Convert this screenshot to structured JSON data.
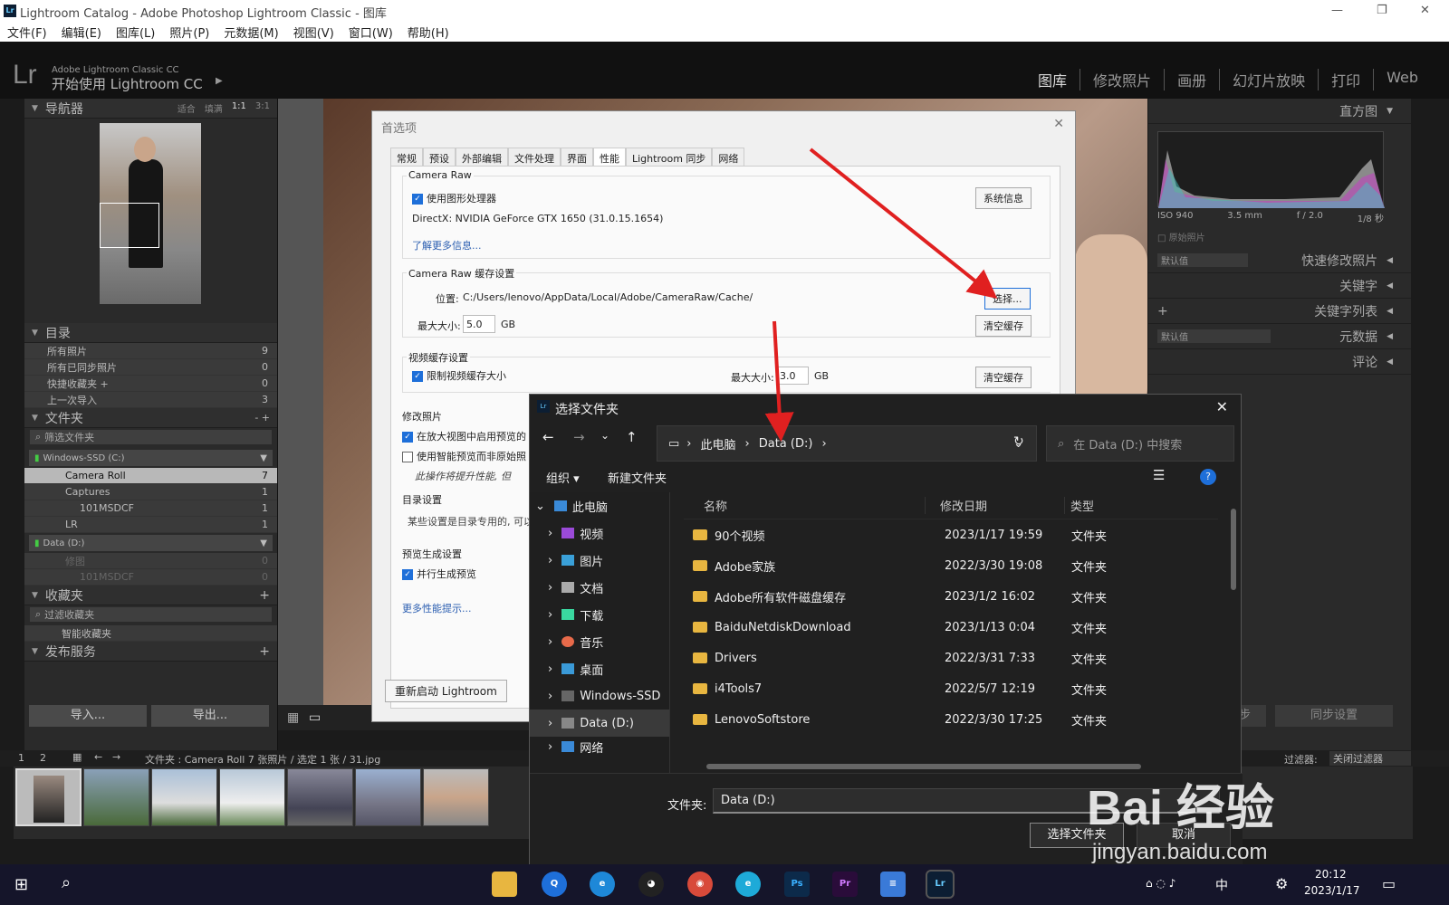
{
  "window": {
    "title": "Lightroom Catalog - Adobe Photoshop Lightroom Classic - 图库"
  },
  "menu": [
    "文件(F)",
    "编辑(E)",
    "图库(L)",
    "照片(P)",
    "元数据(M)",
    "视图(V)",
    "窗口(W)",
    "帮助(H)"
  ],
  "lr_header": {
    "logo": "Lr",
    "sub1": "Adobe Lightroom Classic CC",
    "sub2": "开始使用 Lightroom CC",
    "modules": [
      "图库",
      "修改照片",
      "画册",
      "幻灯片放映",
      "打印",
      "Web"
    ]
  },
  "navigator": {
    "title": "导航器",
    "opts": [
      "适合",
      "填满",
      "1:1",
      "3:1"
    ]
  },
  "catalog": {
    "title": "目录",
    "rows": [
      {
        "label": "所有照片",
        "count": "9"
      },
      {
        "label": "所有已同步照片",
        "count": "0"
      },
      {
        "label": "快捷收藏夹 +",
        "count": "0"
      },
      {
        "label": "上一次导入",
        "count": "3"
      }
    ]
  },
  "folders": {
    "title": "文件夹",
    "filter": "筛选文件夹",
    "vol1": "Windows-SSD (C:)",
    "vol2": "Data (D:)",
    "rows": [
      {
        "label": "Camera Roll",
        "count": "7"
      },
      {
        "label": "Captures",
        "count": "1"
      },
      {
        "label": "101MSDCF",
        "count": "1"
      },
      {
        "label": "LR",
        "count": "1"
      },
      {
        "label": "修图",
        "count": "0"
      },
      {
        "label": "101MSDCF",
        "count": "0"
      }
    ]
  },
  "collections": {
    "title": "收藏夹",
    "filter": "过滤收藏夹",
    "smart": "智能收藏夹"
  },
  "publish": {
    "title": "发布服务",
    "import": "导入...",
    "export": "导出..."
  },
  "right": {
    "histogram": "直方图",
    "iso": "ISO 940",
    "focal": "3.5 mm",
    "fstop": "f / 2.0",
    "shutter": "1/8 秒",
    "original": "原始照片",
    "rows": [
      "快速修改照片",
      "关键字",
      "关键字列表",
      "元数据",
      "评论"
    ],
    "default1": "默认值",
    "default2": "默认值",
    "sync": "同步设置",
    "sync_meta": "同步",
    "filter_label": "过滤器:",
    "filter_value": "关闭过滤器"
  },
  "filmbar": {
    "text": "文件夹 : Camera Roll   7 张照片 / 选定 1 张 / 31.jpg"
  },
  "prefs": {
    "title": "首选项",
    "tabs": [
      "常规",
      "预设",
      "外部编辑",
      "文件处理",
      "界面",
      "性能",
      "Lightroom 同步",
      "网络"
    ],
    "camera_raw": "Camera Raw",
    "use_gpu": "使用图形处理器",
    "sysinfo": "系统信息",
    "directx": "DirectX: NVIDIA GeForce GTX 1650 (31.0.15.1654)",
    "learn_more": "了解更多信息...",
    "cache_title": "Camera Raw 缓存设置",
    "location_label": "位置:",
    "location": "C:/Users/lenovo/AppData/Local/Adobe/CameraRaw/Cache/",
    "choose": "选择...",
    "max_size_label": "最大大小:",
    "max_size": "5.0",
    "gb": "GB",
    "purge": "清空缓存",
    "video_title": "视频缓存设置",
    "limit_video": "限制视频缓存大小",
    "video_max_label": "最大大小:",
    "video_max": "3.0",
    "video_purge": "清空缓存",
    "develop_title": "修改照片",
    "dev1": "在放大视图中启用预览的",
    "dev2": "使用智能预览而非原始照",
    "dev_note": "此操作将提升性能, 但",
    "catalog_title": "目录设置",
    "catalog_note": "某些设置是目录专用的, 可以",
    "preview_title": "预览生成设置",
    "parallel": "并行生成预览",
    "more_perf": "更多性能提示...",
    "restart": "重新启动 Lightroom"
  },
  "folder_dialog": {
    "title": "选择文件夹",
    "path": [
      "此电脑",
      "Data (D:)"
    ],
    "search_placeholder": "在 Data (D:) 中搜索",
    "organize": "组织 ▾",
    "new_folder": "新建文件夹",
    "sidebar": [
      "此电脑",
      "视频",
      "图片",
      "文档",
      "下载",
      "音乐",
      "桌面",
      "Windows-SSD",
      "Data (D:)",
      "网络"
    ],
    "columns": [
      "名称",
      "修改日期",
      "类型"
    ],
    "rows": [
      {
        "name": "90个视频",
        "date": "2023/1/17 19:59",
        "type": "文件夹"
      },
      {
        "name": "Adobe家族",
        "date": "2022/3/30 19:08",
        "type": "文件夹"
      },
      {
        "name": "Adobe所有软件磁盘缓存",
        "date": "2023/1/2 16:02",
        "type": "文件夹"
      },
      {
        "name": "BaiduNetdiskDownload",
        "date": "2023/1/13 0:04",
        "type": "文件夹"
      },
      {
        "name": "Drivers",
        "date": "2022/3/31 7:33",
        "type": "文件夹"
      },
      {
        "name": "i4Tools7",
        "date": "2022/5/7 12:19",
        "type": "文件夹"
      },
      {
        "name": "LenovoSoftstore",
        "date": "2022/3/30 17:25",
        "type": "文件夹"
      }
    ],
    "folder_label": "文件夹:",
    "folder_value": "Data (D:)",
    "select_btn": "选择文件夹",
    "cancel_btn": "取消"
  },
  "taskbar": {
    "time": "20:12",
    "date": "2023/1/17",
    "ime": "中"
  },
  "watermark": {
    "brand": "Bai 经验",
    "url": "jingyan.baidu.com"
  }
}
